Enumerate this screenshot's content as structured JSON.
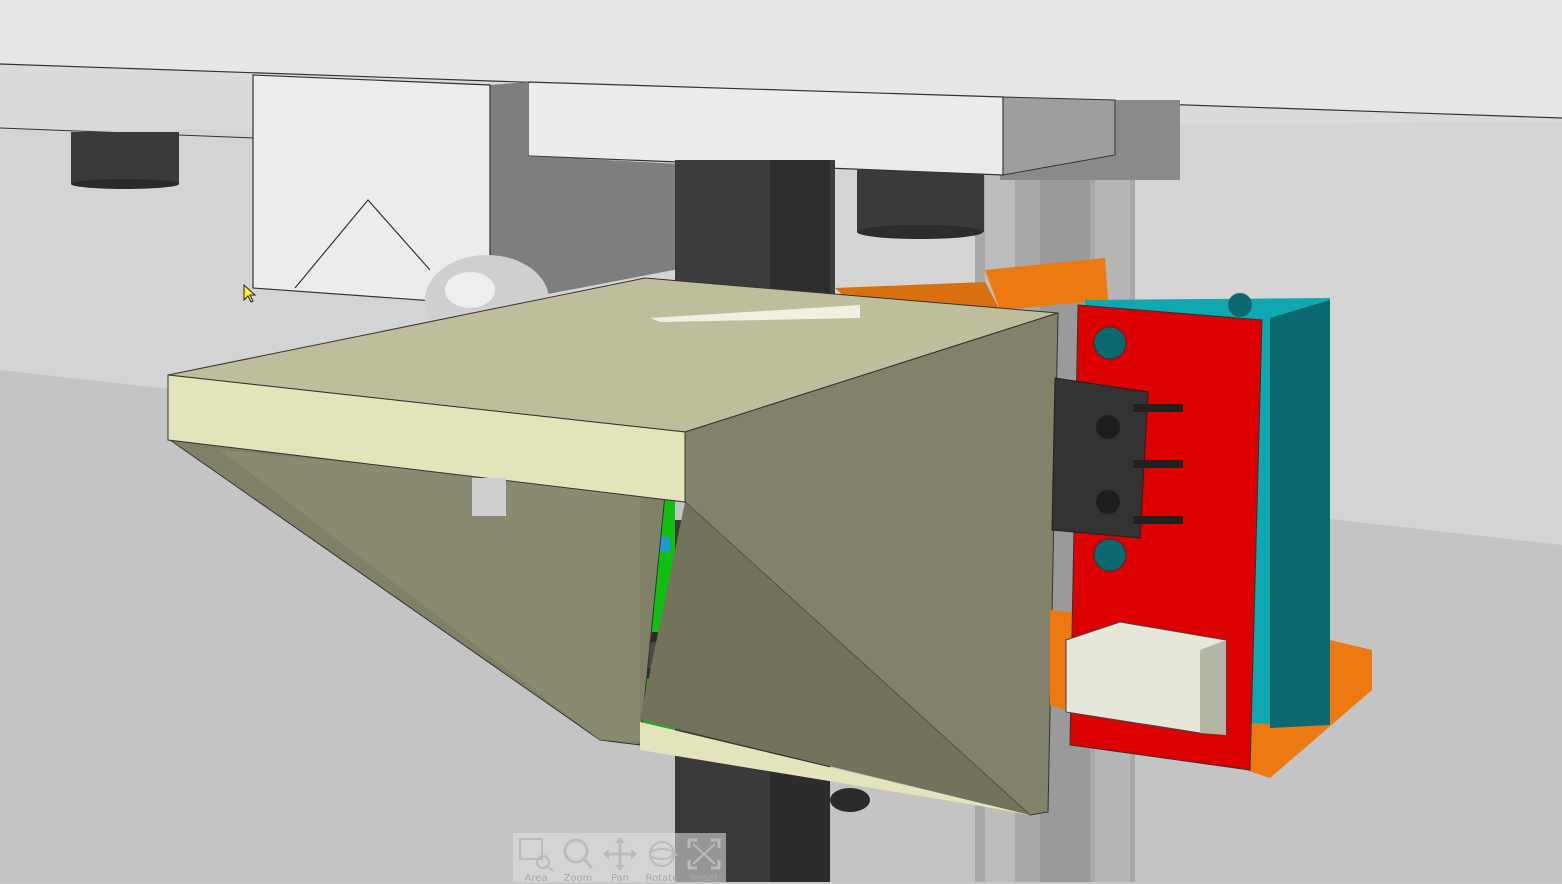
{
  "viewer": {
    "scene": "3D CAD model view",
    "colors": {
      "ceiling": "#e4e4e4",
      "wall": "#d2d2d2",
      "floor": "#c2c2c2",
      "bracket_top": "#e2e2b8",
      "bracket_side": "#82826a",
      "rail": "#3c3c3c",
      "carriage": "#10c010",
      "pcb": "#dd0000",
      "spacer": "#10a8b0",
      "mount": "#ec7a10"
    }
  },
  "toolbar": {
    "tools": [
      {
        "label": "Area",
        "icon": "area-zoom-icon"
      },
      {
        "label": "Zoom",
        "icon": "zoom-icon"
      },
      {
        "label": "Pan",
        "icon": "pan-icon"
      },
      {
        "label": "Rotate",
        "icon": "rotate-icon"
      },
      {
        "label": "Reset",
        "icon": "reset-view-icon"
      }
    ]
  }
}
